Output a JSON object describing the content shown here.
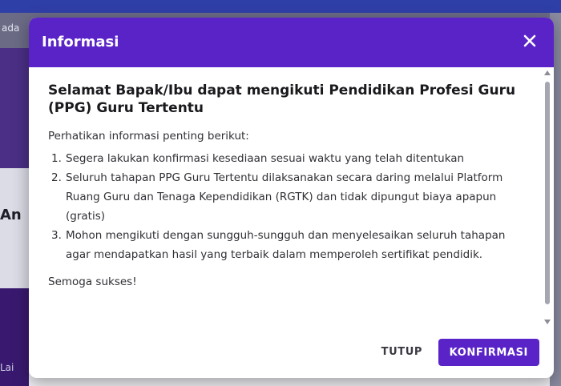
{
  "background": {
    "strip_text": "ada",
    "left_heading": "An",
    "bottom_text": "Lai"
  },
  "dialog": {
    "title": "Informasi",
    "heading": "Selamat Bapak/Ibu dapat mengikuti Pendidikan Profesi Guru (PPG) Guru Tertentu",
    "intro": "Perhatikan informasi penting berikut:",
    "points": [
      {
        "num": "1.",
        "text": "Segera lakukan konfirmasi kesediaan sesuai waktu yang telah ditentukan"
      },
      {
        "num": "2.",
        "text": "Seluruh tahapan PPG Guru Tertentu dilaksanakan secara daring melalui Platform Ruang Guru dan Tenaga Kependidikan (RGTK) dan tidak dipungut biaya apapun (gratis)"
      },
      {
        "num": "3.",
        "text": "Mohon mengikuti dengan sungguh-sungguh dan menyelesaikan seluruh tahapan agar mendapatkan hasil yang terbaik dalam memperoleh sertifikat pendidik."
      }
    ],
    "closing": "Semoga sukses!",
    "buttons": {
      "cancel": "TUTUP",
      "confirm": "KONFIRMASI"
    }
  },
  "icons": {
    "close": "close-icon"
  },
  "colors": {
    "accent": "#5a23c8",
    "header_text": "#ffffff"
  }
}
